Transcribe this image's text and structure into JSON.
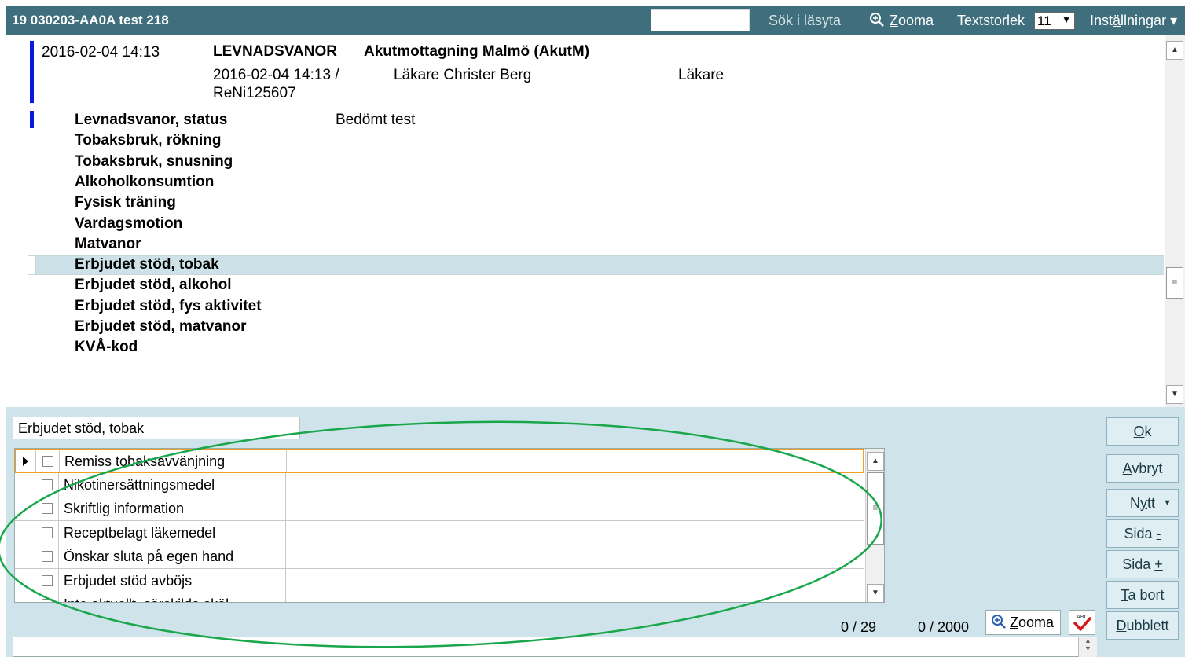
{
  "titlebar": {
    "title": "19 030203-AA0A test 218",
    "search_label": "Sök i läsyta",
    "zoom_prefix": "",
    "zoom_ul": "Z",
    "zoom_rest": "ooma",
    "textsize_label": "Textstorlek",
    "textsize_value": "11",
    "settings_pre": "Inst",
    "settings_ul": "ä",
    "settings_post": "llningar ▾"
  },
  "entry": {
    "datetime": "2016-02-04 14:13",
    "heading": "LEVNADSVANOR",
    "unit": "Akutmottagning Malmö (AkutM)",
    "sign_date": "2016-02-04 14:13 /",
    "sign_id": "ReNi125607",
    "author": "Läkare Christer Berg",
    "role": "Läkare"
  },
  "keywords": [
    {
      "label": "Levnadsvanor, status",
      "value": "Bedömt test"
    },
    {
      "label": "Tobaksbruk, rökning",
      "value": ""
    },
    {
      "label": "Tobaksbruk, snusning",
      "value": ""
    },
    {
      "label": "Alkoholkonsumtion",
      "value": ""
    },
    {
      "label": "Fysisk träning",
      "value": ""
    },
    {
      "label": "Vardagsmotion",
      "value": ""
    },
    {
      "label": "Matvanor",
      "value": ""
    },
    {
      "label": "Erbjudet stöd, tobak",
      "value": ""
    },
    {
      "label": "Erbjudet stöd, alkohol",
      "value": ""
    },
    {
      "label": "Erbjudet stöd, fys aktivitet",
      "value": ""
    },
    {
      "label": "Erbjudet stöd, matvanor",
      "value": ""
    },
    {
      "label": "KVÅ-kod",
      "value": ""
    }
  ],
  "selected_keyword": "Erbjudet stöd, tobak",
  "options": [
    "Remiss tobaksavvänjning",
    "Nikotinersättningsmedel",
    "Skriftlig information",
    "Receptbelagt läkemedel",
    "Önskar sluta på egen hand",
    "Erbjudet stöd avböjs",
    "Inte aktuellt, särskilda skäl"
  ],
  "buttons": {
    "ok_ul": "O",
    "ok_rest": "k",
    "cancel_ul": "A",
    "cancel_rest": "vbryt",
    "new_pre": "N",
    "new_ul": "y",
    "new_post": "tt",
    "page_prev_pre": "Sida ",
    "page_prev_ul": "-",
    "page_next_pre": "Sida ",
    "page_next_ul": "+",
    "delete_ul": "T",
    "delete_rest": "a bort",
    "duplicate_ul": "D",
    "duplicate_rest": "ubblett"
  },
  "counters": {
    "chars_short": "0 / 29",
    "chars_long": "0 / 2000"
  },
  "zoom_small_ul": "Z",
  "zoom_small_rest": "ooma",
  "colors": {
    "title_bg": "#3f6f7c",
    "accent_bar": "#0a18d8",
    "panel_bg": "#cfe4ea",
    "annotation": "#1aa64a"
  }
}
